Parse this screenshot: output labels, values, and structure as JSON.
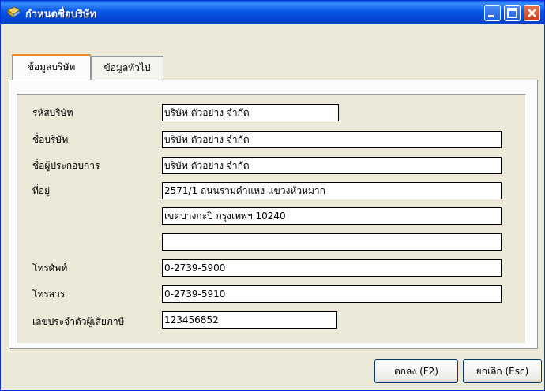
{
  "window": {
    "title": "กำหนดชื่อบริษัท"
  },
  "tabs": [
    {
      "label": "ข้อมูลบริษัท",
      "active": true
    },
    {
      "label": "ข้อมูลทั่วไป",
      "active": false
    }
  ],
  "form": {
    "company_code": {
      "label": "รหัสบริษัท",
      "value": "บริษัท ตัวอย่าง จำกัด"
    },
    "company_name": {
      "label": "ชื่อบริษัท",
      "value": "บริษัท ตัวอย่าง จำกัด"
    },
    "operator_name": {
      "label": "ชื่อผู้ประกอบการ",
      "value": "บริษัท ตัวอย่าง จำกัด"
    },
    "address": {
      "label": "ที่อยู่",
      "line1": "2571/1 ถนนรามคำแหง แขวงหัวหมาก",
      "line2": "เขตบางกะปิ กรุงเทพฯ 10240",
      "line3": ""
    },
    "phone": {
      "label": "โทรศัพท์",
      "value": "0-2739-5900"
    },
    "fax": {
      "label": "โทรสาร",
      "value": "0-2739-5910"
    },
    "tax_id": {
      "label": "เลขประจำตัวผู้เสียภาษี",
      "value": "123456852"
    }
  },
  "buttons": {
    "ok": "ตกลง (F2)",
    "cancel": "ยกเลิก (Esc)"
  },
  "colors": {
    "titlebar": "#0856e6",
    "window_bg": "#ece9d8",
    "close_button": "#c8401d"
  }
}
